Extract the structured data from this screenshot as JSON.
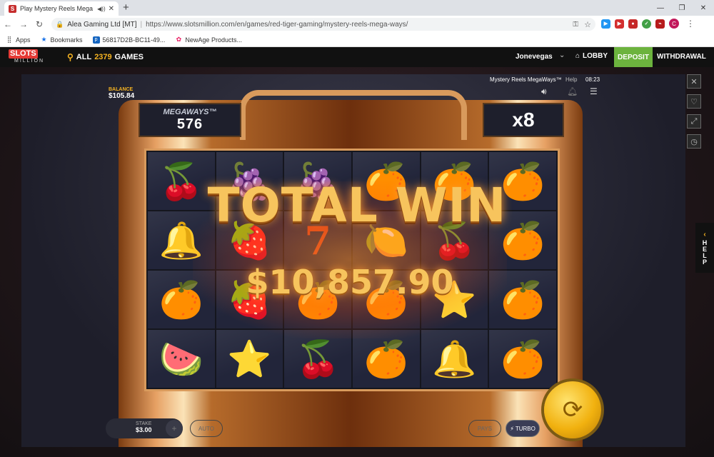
{
  "browser": {
    "tab_title": "Play Mystery Reels Mega Wa",
    "tab_favicon": "S",
    "new_tab": "+",
    "org": "Alea Gaming Ltd [MT]",
    "url": "https://www.slotsmillion.com/en/games/red-tiger-gaming/mystery-reels-mega-ways/",
    "bookmarks": [
      {
        "icon": "apps-grid-icon",
        "label": "Apps"
      },
      {
        "icon": "star-icon",
        "label": "Bookmarks"
      },
      {
        "icon": "p-icon",
        "label": "56817D2B-BC11-49..."
      },
      {
        "icon": "newage-icon",
        "label": "NewAge Products..."
      }
    ],
    "avatar_letter": "C"
  },
  "site": {
    "logo_top": "SLOTS",
    "logo_bottom": "MILLION",
    "all_label": "ALL",
    "games_count": "2379",
    "games_label": "GAMES",
    "username": "Jonevegas",
    "lobby": "LOBBY",
    "deposit": "DEPOSIT",
    "withdrawal": "WITHDRAWAL",
    "accent_color": "#6cb33e",
    "gold_color": "#f5b321"
  },
  "game": {
    "balance_label": "BALANCE",
    "balance_value": "$105.84",
    "title": "Mystery Reels MegaWays™",
    "help": "Help",
    "time": "08:23",
    "megaways_label": "MEGAWAYS™",
    "megaways_value": "576",
    "multiplier": "x8",
    "total_win_label": "TOTAL WIN",
    "total_win_amount": "$10,857.90",
    "stake_label": "STAKE",
    "stake_value": "$3.00",
    "auto_label": "AUTO",
    "pays_label": "PAYS",
    "turbo_label": "TURBO",
    "side_help": "HELP",
    "grid": [
      [
        "cherries",
        "plum-left",
        "plum",
        "orange",
        "orange",
        "orange"
      ],
      [
        "bell",
        "raspberry",
        "seven",
        "lemon",
        "cherries",
        "orange"
      ],
      [
        "orange",
        "raspberry",
        "orange",
        "orange",
        "star",
        "orange"
      ],
      [
        "watermelon",
        "star",
        "cherries",
        "orange",
        "bell",
        "orange"
      ]
    ]
  }
}
